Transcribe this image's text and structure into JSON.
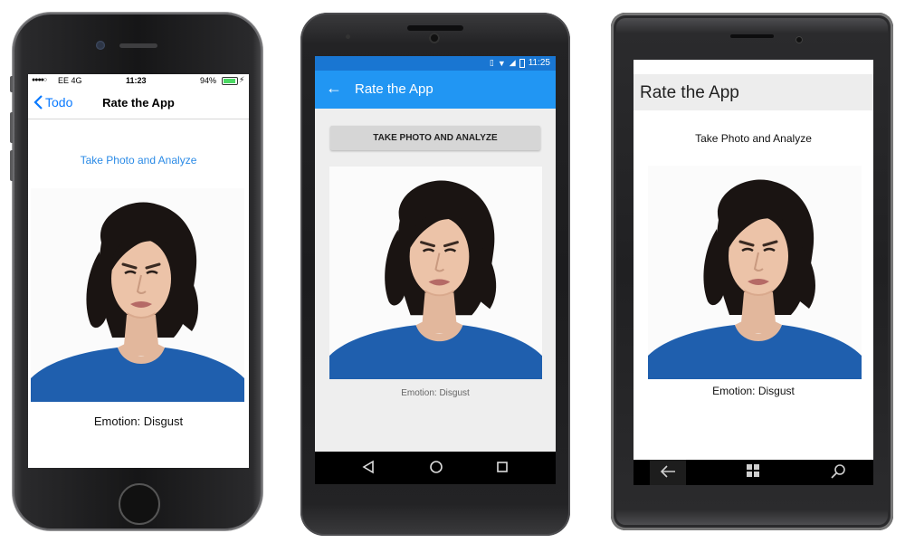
{
  "ios": {
    "status": {
      "signal": "●●●●○",
      "carrier": "EE  4G",
      "time": "11:23",
      "battery": "94%"
    },
    "nav": {
      "back_label": "Todo",
      "title": "Rate the App"
    },
    "action_link": "Take Photo and Analyze",
    "emotion_text": "Emotion:  Disgust"
  },
  "android": {
    "status": {
      "time": "11:25"
    },
    "toolbar": {
      "title": "Rate the App"
    },
    "action_button": "TAKE PHOTO AND ANALYZE",
    "emotion_text": "Emotion:  Disgust"
  },
  "windows": {
    "title": "Rate the App",
    "action_link": "Take Photo and Analyze",
    "emotion_text": "Emotion:  Disgust"
  },
  "colors": {
    "ios_tint": "#0a7aff",
    "android_primary": "#2196f3",
    "android_status": "#1976d2",
    "photo_shirt": "#1f5fae",
    "photo_hair": "#1a1412"
  },
  "icons": [
    "chevron-left-icon",
    "arrow-left-icon",
    "back-triangle-icon",
    "home-circle-icon",
    "recents-square-icon",
    "windows-back-icon",
    "windows-logo-icon",
    "search-icon",
    "wifi-icon",
    "vibrate-icon"
  ]
}
